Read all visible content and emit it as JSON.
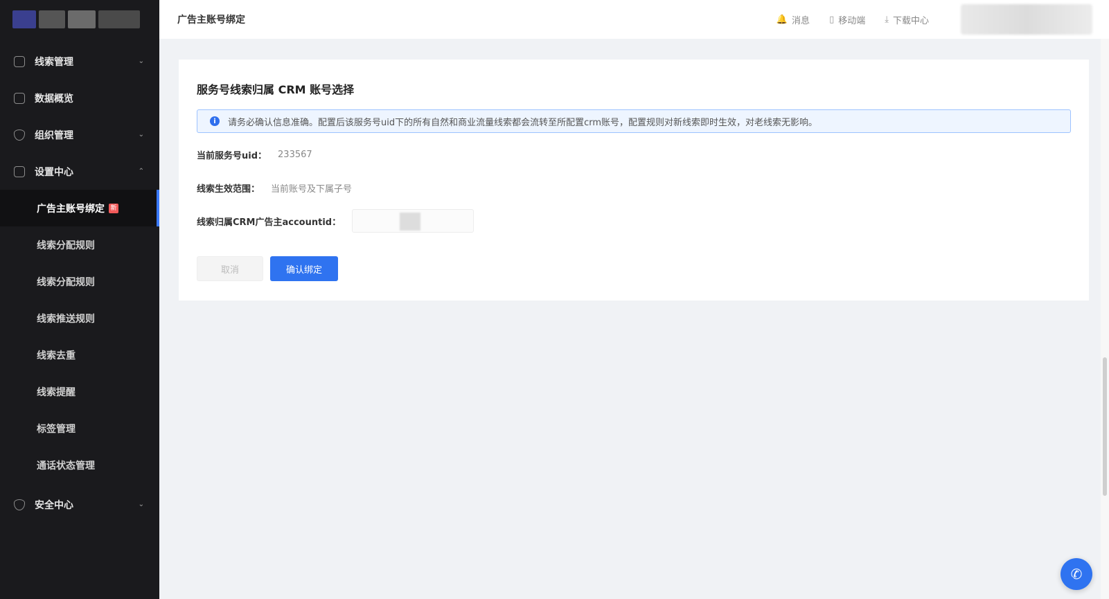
{
  "header": {
    "title": "广告主账号绑定",
    "actions": [
      {
        "icon": "bell-icon",
        "glyph": "🔔",
        "label": "消息"
      },
      {
        "icon": "mobile-icon",
        "glyph": "▯",
        "label": "移动端"
      },
      {
        "icon": "download-icon",
        "glyph": "⤓",
        "label": "下载中心"
      }
    ]
  },
  "sidebar": {
    "items": [
      {
        "label": "线索管理",
        "chevron": "⌄"
      },
      {
        "label": "数据概览"
      },
      {
        "label": "组织管理",
        "chevron": "⌄"
      },
      {
        "label": "设置中心",
        "chevron": "⌃"
      }
    ],
    "sub_items": [
      {
        "label": "广告主账号绑定",
        "badge": "新"
      },
      {
        "label": "线索分配规则"
      },
      {
        "label": "线索分配规则"
      },
      {
        "label": "线索推送规则"
      },
      {
        "label": "线索去重"
      },
      {
        "label": "线索提醒"
      },
      {
        "label": "标签管理"
      },
      {
        "label": "通话状态管理"
      }
    ],
    "security": {
      "label": "安全中心",
      "chevron": "⌄"
    }
  },
  "card": {
    "title": "服务号线索归属 CRM 账号选择",
    "alert": "请务必确认信息准确。配置后该服务号uid下的所有自然和商业流量线索都会流转至所配置crm账号，配置规则对新线索即时生效，对老线索无影响。",
    "uid_label": "当前服务号uid：",
    "uid_value": "233567",
    "scope_label": "线索生效范围：",
    "scope_value": "当前账号及下属子号",
    "account_label": "线索归属CRM广告主accountid：",
    "cancel_label": "取消",
    "confirm_label": "确认绑定"
  },
  "colors": {
    "sidebar_bg": "#1a1a1d",
    "primary": "#2f73f0",
    "alert_border": "#9cc2ff"
  }
}
